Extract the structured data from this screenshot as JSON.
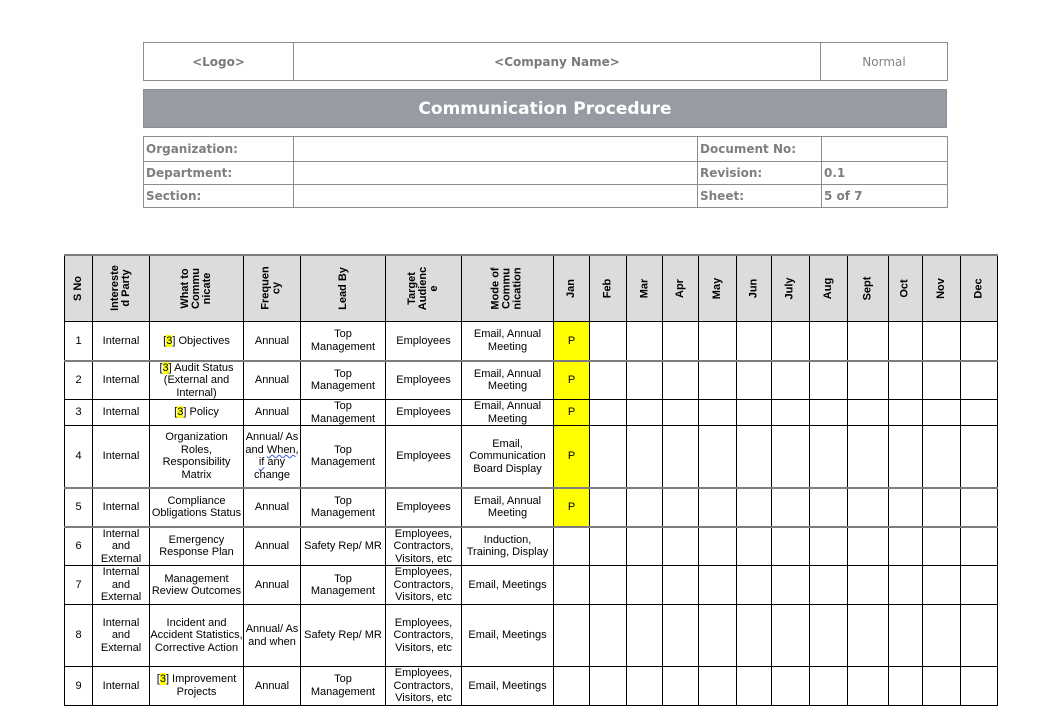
{
  "header": {
    "logo": "<Logo>",
    "company_name": "<Company Name>",
    "status": "Normal"
  },
  "title": "Communication Procedure",
  "info": {
    "organization_label": "Organization:",
    "organization_value": "",
    "department_label": "Department:",
    "department_value": "",
    "section_label": "Section:",
    "section_value": "",
    "document_no_label": "Document No:",
    "document_no_value": "",
    "revision_label": "Revision:",
    "revision_value": "0.1",
    "sheet_label": "Sheet:",
    "sheet_value": "5 of 7"
  },
  "matrix": {
    "columns": [
      "S No",
      "Intereste|d Party",
      "What to|Commu|nicate",
      "Frequen|cy",
      "Lead By",
      "Target|Audienc|e",
      "Mode of|Commu|nication"
    ],
    "months": [
      "Jan",
      "Feb",
      "Mar",
      "Apr",
      "May",
      "Jun",
      "July",
      "Aug",
      "Sept",
      "Oct",
      "Nov",
      "Dec"
    ],
    "highlight_color": "#ffff00",
    "ref_tag": "3",
    "rows": [
      {
        "sno": "1",
        "party": "Internal",
        "ref": true,
        "what": " Objectives",
        "freq": "Annual",
        "lead": "Top Management",
        "audience": "Employees",
        "mode": "Email, Annual Meeting",
        "marks": [
          "P",
          "",
          "",
          "",
          "",
          "",
          "",
          "",
          "",
          "",
          "",
          ""
        ]
      },
      {
        "sno": "2",
        "party": "Internal",
        "ref": true,
        "what": " Audit Status (External and Internal)",
        "freq": "Annual",
        "lead": "Top Management",
        "audience": "Employees",
        "mode": "Email, Annual Meeting",
        "marks": [
          "P",
          "",
          "",
          "",
          "",
          "",
          "",
          "",
          "",
          "",
          "",
          ""
        ]
      },
      {
        "sno": "3",
        "party": "Internal",
        "ref": true,
        "what": " Policy",
        "freq": "Annual",
        "lead": "Top Management",
        "audience": "Employees",
        "mode": "Email, Annual Meeting",
        "marks": [
          "P",
          "",
          "",
          "",
          "",
          "",
          "",
          "",
          "",
          "",
          "",
          ""
        ]
      },
      {
        "sno": "4",
        "party": "Internal",
        "ref": false,
        "what": "Organization Roles, Responsibility Matrix",
        "freq": "Annual/ As and When, if any change",
        "lead": "Top Management",
        "audience": "Employees",
        "mode": "Email, Communication Board Display",
        "marks": [
          "P",
          "",
          "",
          "",
          "",
          "",
          "",
          "",
          "",
          "",
          "",
          ""
        ]
      },
      {
        "sno": "5",
        "party": "Internal",
        "ref": false,
        "what": "Compliance Obligations Status",
        "freq": "Annual",
        "lead": "Top Management",
        "audience": "Employees",
        "mode": "Email, Annual Meeting",
        "marks": [
          "P",
          "",
          "",
          "",
          "",
          "",
          "",
          "",
          "",
          "",
          "",
          ""
        ]
      },
      {
        "sno": "6",
        "party": "Internal and External",
        "ref": false,
        "what": "Emergency Response Plan",
        "freq": "Annual",
        "lead": "Safety Rep/ MR",
        "audience": "Employees, Contractors, Visitors, etc",
        "mode": "Induction, Training, Display",
        "marks": [
          "",
          "",
          "",
          "",
          "",
          "",
          "",
          "",
          "",
          "",
          "",
          ""
        ]
      },
      {
        "sno": "7",
        "party": "Internal and External",
        "ref": false,
        "what": "Management Review Outcomes",
        "freq": "Annual",
        "lead": "Top Management",
        "audience": "Employees, Contractors, Visitors, etc",
        "mode": "Email, Meetings",
        "marks": [
          "",
          "",
          "",
          "",
          "",
          "",
          "",
          "",
          "",
          "",
          "",
          ""
        ]
      },
      {
        "sno": "8",
        "party": "Internal and External",
        "ref": false,
        "what": "Incident and Accident Statistics, Corrective Action",
        "freq": "Annual/ As and when",
        "lead": "Safety Rep/ MR",
        "audience": "Employees, Contractors, Visitors, etc",
        "mode": "Email, Meetings",
        "marks": [
          "",
          "",
          "",
          "",
          "",
          "",
          "",
          "",
          "",
          "",
          "",
          ""
        ]
      },
      {
        "sno": "9",
        "party": "Internal",
        "ref": true,
        "what": " Improvement Projects",
        "freq": "Annual",
        "lead": "Top Management",
        "audience": "Employees, Contractors, Visitors, etc",
        "mode": "Email, Meetings",
        "marks": [
          "",
          "",
          "",
          "",
          "",
          "",
          "",
          "",
          "",
          "",
          "",
          ""
        ]
      }
    ]
  }
}
